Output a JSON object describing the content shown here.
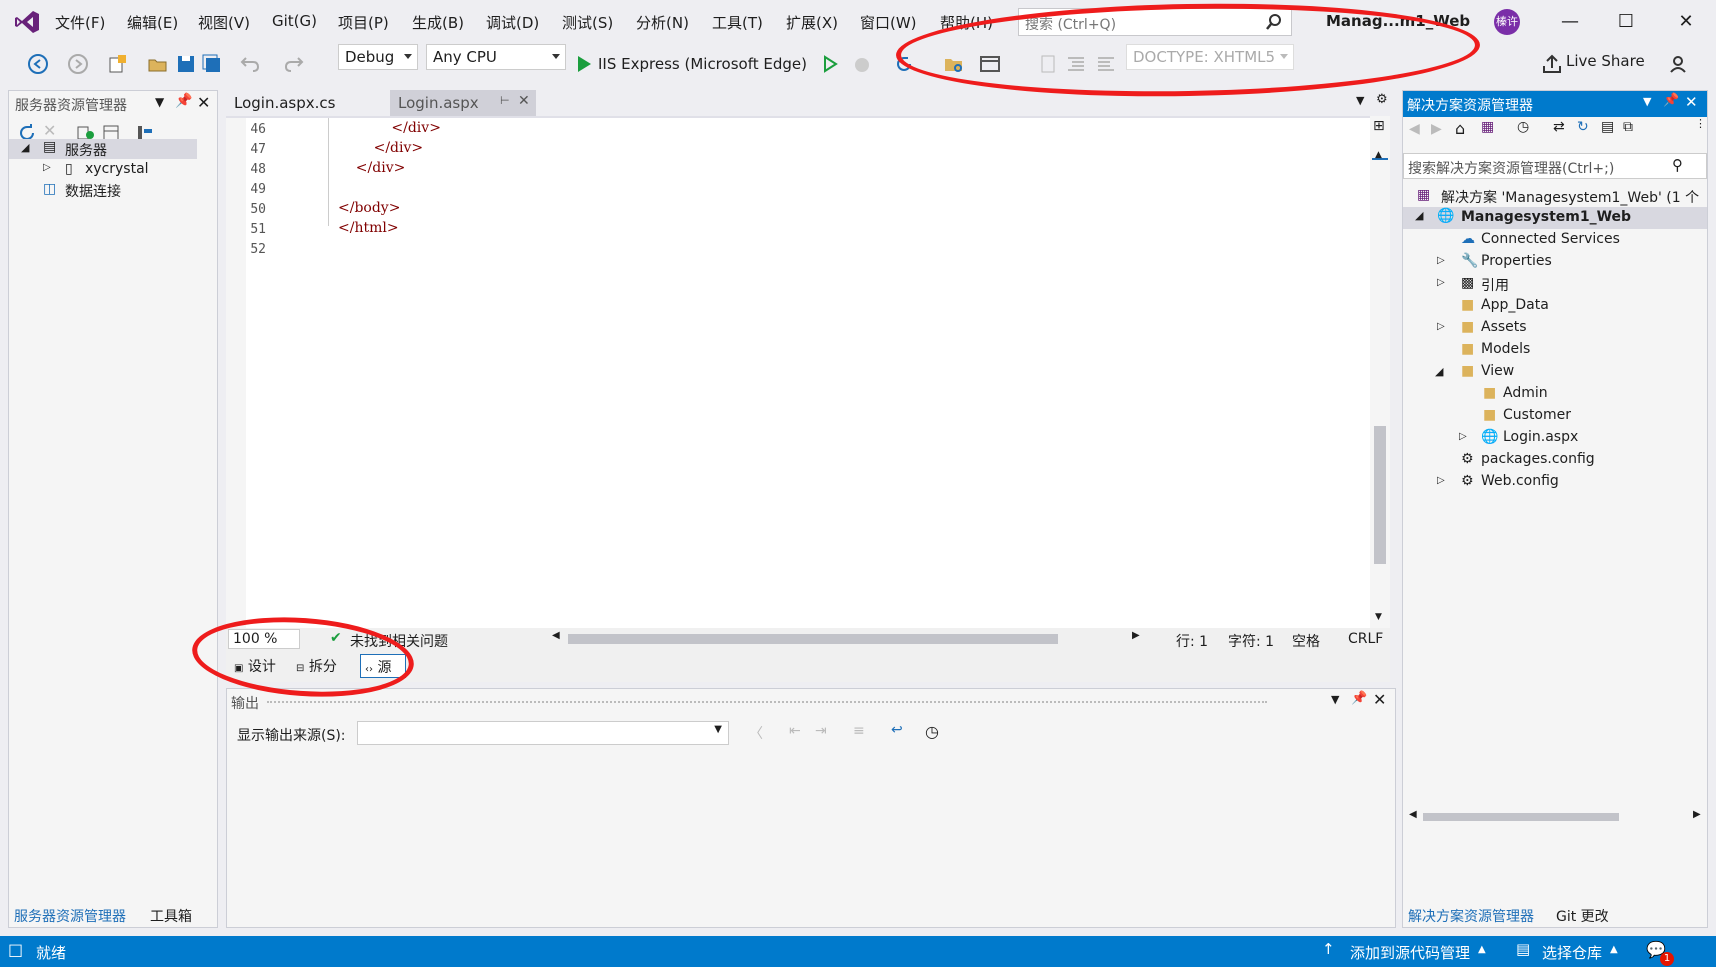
{
  "menu": {
    "items": [
      "文件(F)",
      "编辑(E)",
      "视图(V)",
      "Git(G)",
      "项目(P)",
      "生成(B)",
      "调试(D)",
      "测试(S)",
      "分析(N)",
      "工具(T)",
      "扩展(X)",
      "窗口(W)",
      "帮助(H)"
    ],
    "search_placeholder": "搜索 (Ctrl+Q)",
    "project_title": "Manag...m1_Web",
    "avatar_text": "榛许"
  },
  "toolbar": {
    "config": "Debug",
    "platform": "Any CPU",
    "run_target": "IIS Express (Microsoft Edge)",
    "doctype": "DOCTYPE: XHTML5",
    "live_share": "Live Share"
  },
  "server_explorer": {
    "title": "服务器资源管理器",
    "tree": {
      "servers": "服务器",
      "machine": "xycrystal",
      "data_connections": "数据连接"
    }
  },
  "editor": {
    "tabs": [
      "Login.aspx.cs",
      "Login.aspx"
    ],
    "active_tab": "Login.aspx",
    "lines": [
      {
        "num": "46",
        "code": "            </div>"
      },
      {
        "num": "47",
        "code": "        </div>"
      },
      {
        "num": "48",
        "code": "    </div>"
      },
      {
        "num": "49",
        "code": ""
      },
      {
        "num": "50",
        "code": "</body>"
      },
      {
        "num": "51",
        "code": "</html>"
      },
      {
        "num": "52",
        "code": ""
      }
    ],
    "zoom": "100 %",
    "issues": "未找到相关问题",
    "row": "行: 1",
    "col": "字符: 1",
    "whitespace": "空格",
    "eol": "CRLF",
    "view_tabs": [
      "设计",
      "拆分",
      "源"
    ]
  },
  "output": {
    "title": "输出",
    "source_label": "显示输出来源(S):"
  },
  "solution_explorer": {
    "title": "解决方案资源管理器",
    "search_placeholder": "搜索解决方案资源管理器(Ctrl+;)",
    "solution": "解决方案 'Managesystem1_Web' (1 个",
    "project": "Managesystem1_Web",
    "items": [
      "Connected Services",
      "Properties",
      "引用",
      "App_Data",
      "Assets",
      "Models",
      "View",
      "Admin",
      "Customer",
      "Login.aspx",
      "packages.config",
      "Web.config"
    ]
  },
  "bottom_tabs": {
    "left": [
      "服务器资源管理器",
      "工具箱"
    ],
    "right": [
      "解决方案资源管理器",
      "Git 更改"
    ]
  },
  "status": {
    "ready": "就绪",
    "add_source": "添加到源代码管理",
    "select_repo": "选择仓库",
    "notif_count": "1"
  },
  "colors": {
    "accent": "#007acc",
    "annotation": "#ee1c1c"
  }
}
